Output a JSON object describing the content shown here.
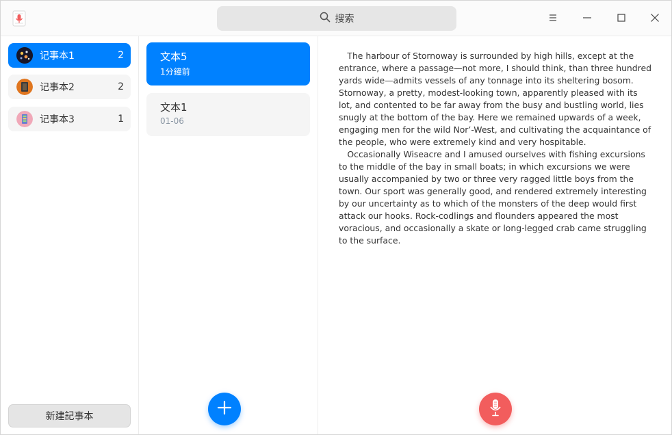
{
  "titlebar": {
    "search_placeholder": "搜索"
  },
  "sidebar": {
    "notebooks": [
      {
        "name": "记事本1",
        "count": "2",
        "active": true
      },
      {
        "name": "记事本2",
        "count": "2",
        "active": false
      },
      {
        "name": "记事本3",
        "count": "1",
        "active": false
      }
    ],
    "new_button_label": "新建記事本"
  },
  "notelist": {
    "notes": [
      {
        "title": "文本5",
        "time": "1分鐘前",
        "active": true
      },
      {
        "title": "文本1",
        "time": "01-06",
        "active": false
      }
    ]
  },
  "editor": {
    "paragraphs": [
      "The harbour of Stornoway is surrounded by high hills, except at the entrance, where a passage—not more, I should think, than three hundred yards wide—admits vessels of any tonnage into its sheltering bosom. Stornoway, a pretty, modest-looking town, apparently pleased with its lot, and contented to be far away from the busy and bustling world, lies snugly at the bottom of the bay. Here we remained upwards of a week, engaging men for the wild Nor’-West, and cultivating the acquaintance of the people, who were extremely kind and very hospitable.",
      "Occasionally Wiseacre and I amused ourselves with fishing excursions to the middle of the bay in small boats; in which excursions we were usually accompanied by two or three very ragged little boys from the town. Our sport was generally good, and rendered extremely interesting by our uncertainty as to which of the monsters of the deep would first attack our hooks. Rock-codlings and flounders appeared the most voracious, and occasionally a skate or long-legged crab came struggling to the surface."
    ]
  },
  "icons": {
    "app": "voice-notes-app-icon",
    "search": "search-icon",
    "menu": "hamburger-menu-icon",
    "minimize": "minimize-icon",
    "maximize": "maximize-icon",
    "close": "close-icon",
    "add": "plus-icon",
    "record": "microphone-icon"
  },
  "colors": {
    "accent": "#0081ff",
    "record": "#f25d5d"
  }
}
